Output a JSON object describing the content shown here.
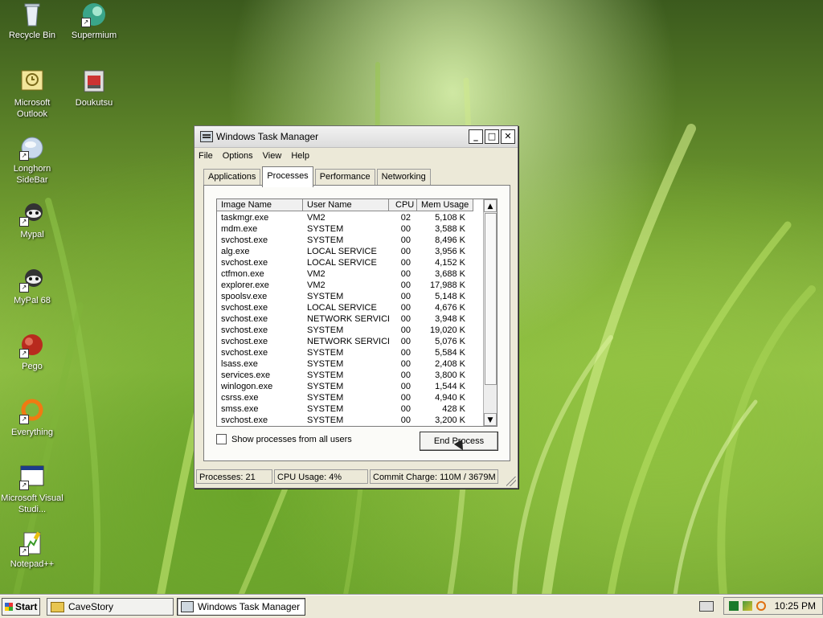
{
  "desktop": {
    "icons": [
      {
        "label": "Recycle Bin"
      },
      {
        "label": "Supermium"
      },
      {
        "label": "Microsoft Outlook"
      },
      {
        "label": "Doukutsu"
      },
      {
        "label": "Longhorn SideBar"
      },
      {
        "label": "Mypal"
      },
      {
        "label": "MyPal 68"
      },
      {
        "label": "Pego"
      },
      {
        "label": "Everything"
      },
      {
        "label": "Microsoft Visual Studi..."
      },
      {
        "label": "Notepad++"
      }
    ]
  },
  "window": {
    "title": "Windows Task Manager",
    "buttons": {
      "minimize": "_",
      "maximize": "□",
      "close": "✕"
    },
    "menu": [
      "File",
      "Options",
      "View",
      "Help"
    ],
    "tabs": [
      "Applications",
      "Processes",
      "Performance",
      "Networking"
    ],
    "active_tab": "Processes",
    "columns": [
      "Image Name",
      "User Name",
      "CPU",
      "Mem Usage"
    ],
    "processes": [
      [
        "taskmgr.exe",
        "VM2",
        "02",
        "5,108 K"
      ],
      [
        "mdm.exe",
        "SYSTEM",
        "00",
        "3,588 K"
      ],
      [
        "svchost.exe",
        "SYSTEM",
        "00",
        "8,496 K"
      ],
      [
        "alg.exe",
        "LOCAL SERVICE",
        "00",
        "3,956 K"
      ],
      [
        "svchost.exe",
        "LOCAL SERVICE",
        "00",
        "4,152 K"
      ],
      [
        "ctfmon.exe",
        "VM2",
        "00",
        "3,688 K"
      ],
      [
        "explorer.exe",
        "VM2",
        "00",
        "17,988 K"
      ],
      [
        "spoolsv.exe",
        "SYSTEM",
        "00",
        "5,148 K"
      ],
      [
        "svchost.exe",
        "LOCAL SERVICE",
        "00",
        "4,676 K"
      ],
      [
        "svchost.exe",
        "NETWORK SERVICE",
        "00",
        "3,948 K"
      ],
      [
        "svchost.exe",
        "SYSTEM",
        "00",
        "19,020 K"
      ],
      [
        "svchost.exe",
        "NETWORK SERVICE",
        "00",
        "5,076 K"
      ],
      [
        "svchost.exe",
        "SYSTEM",
        "00",
        "5,584 K"
      ],
      [
        "lsass.exe",
        "SYSTEM",
        "00",
        "2,408 K"
      ],
      [
        "services.exe",
        "SYSTEM",
        "00",
        "3,800 K"
      ],
      [
        "winlogon.exe",
        "SYSTEM",
        "00",
        "1,544 K"
      ],
      [
        "csrss.exe",
        "SYSTEM",
        "00",
        "4,940 K"
      ],
      [
        "smss.exe",
        "SYSTEM",
        "00",
        "428 K"
      ],
      [
        "svchost.exe",
        "SYSTEM",
        "00",
        "3,200 K"
      ]
    ],
    "show_all_label": "Show processes from all users",
    "end_process_label": "End Process",
    "status": {
      "processes": "Processes: 21",
      "cpu": "CPU Usage: 4%",
      "commit": "Commit Charge: 110M / 3679M"
    }
  },
  "taskbar": {
    "start_label": "Start",
    "tasks": [
      {
        "label": "CaveStory",
        "active": false
      },
      {
        "label": "Windows Task Manager",
        "active": true
      }
    ],
    "clock": "10:25 PM"
  },
  "colors": {
    "window_bg": "#ece9d8",
    "selected_row": "#ffffff"
  }
}
